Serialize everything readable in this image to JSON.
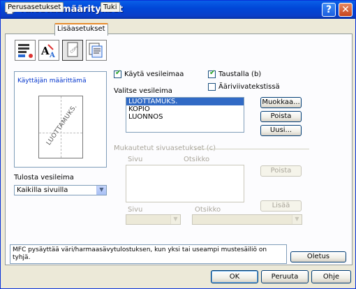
{
  "window": {
    "title": "Tulostusmääritykset"
  },
  "tabs": [
    {
      "label": "Perusasetukset"
    },
    {
      "label": "Lisäasetukset"
    },
    {
      "label": "Tuki"
    }
  ],
  "preview": {
    "label": "Käyttäjän määrittämä",
    "watermark_text": "LUOTTAMUKS."
  },
  "watermark": {
    "use_label": "Käytä vesileimaa",
    "background_label": "Taustalla (b)",
    "outline_label": "Ääriviivatekstissä",
    "select_label": "Valitse vesileima",
    "items": [
      "LUOTTAMUKS.",
      "KOPIO",
      "LUONNOS"
    ],
    "edit_button": "Muokkaa...",
    "delete_button": "Poista",
    "new_button": "Uusi..."
  },
  "print": {
    "label": "Tulosta vesileima",
    "value": "Kaikilla sivuilla"
  },
  "custom": {
    "group_label": "Mukautetut sivuasetukset (c)",
    "col_page": "Sivu",
    "col_title": "Otsikko",
    "delete_button": "Poista",
    "add_button": "Lisää",
    "page_label": "Sivu",
    "title_label": "Otsikko"
  },
  "status": {
    "message": "MFC pysäyttää väri/harmaasävytulostuksen, kun yksi tai useampi mustesäiliö on tyhjä."
  },
  "buttons": {
    "defaults": "Oletus",
    "ok": "OK",
    "cancel": "Peruuta",
    "help": "Ohje"
  }
}
